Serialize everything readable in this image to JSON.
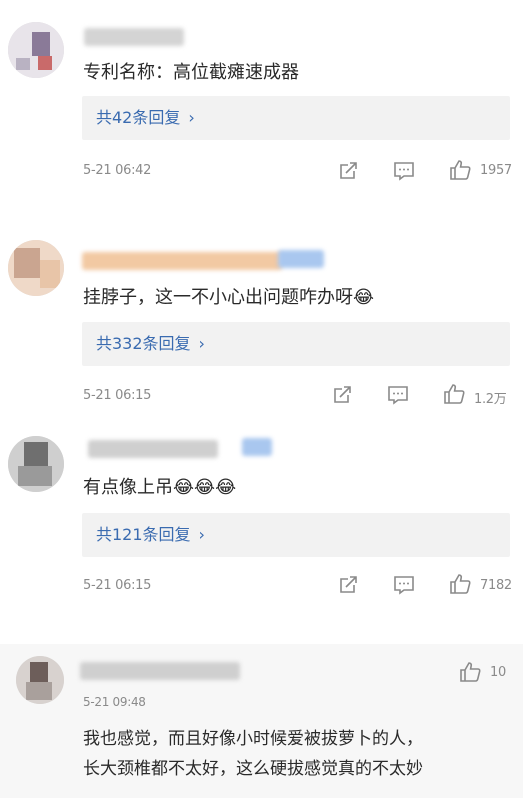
{
  "comments": [
    {
      "text": "专利名称：高位截瘫速成器",
      "replies_label": "共42条回复",
      "chevron": "›",
      "time": "5-21 06:42",
      "likes": "1957",
      "icons": [
        "share-icon",
        "comment-icon",
        "like-icon"
      ]
    },
    {
      "text": "挂脖子，这一不小心出问题咋办呀😂",
      "replies_label": "共332条回复",
      "chevron": "›",
      "time": "5-21 06:15",
      "likes": "1.2万",
      "icons": [
        "share-icon",
        "comment-icon",
        "like-icon"
      ]
    },
    {
      "text": "有点像上吊😂😂😂",
      "replies_label": "共121条回复",
      "chevron": "›",
      "time": "5-21 06:15",
      "likes": "7182",
      "icons": [
        "share-icon",
        "comment-icon",
        "like-icon"
      ]
    }
  ],
  "featured_reply": {
    "time": "5-21 09:48",
    "likes": "10",
    "line1": "我也感觉，而且好像小时候爱被拔萝卜的人，",
    "line2": "长大颈椎都不太好，这么硬拔感觉真的不太妙"
  },
  "colors": {
    "link": "#3a6bb0",
    "meta": "#8a8a8a",
    "reply_bg": "#f2f2f2",
    "band_bg": "#f7f7f7"
  }
}
